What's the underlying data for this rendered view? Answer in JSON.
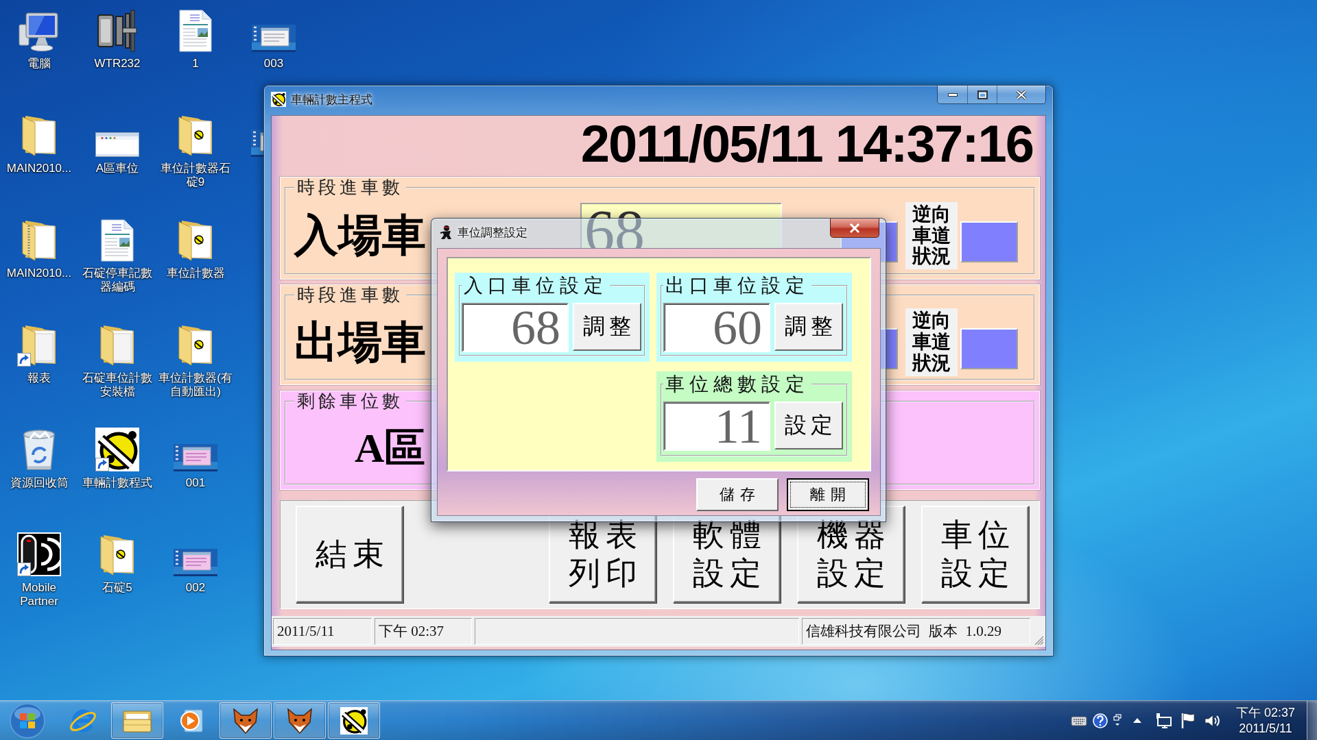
{
  "desktop": {
    "rows": [
      [
        {
          "kind": "computer",
          "label": "電腦",
          "shortcut": false
        },
        {
          "kind": "connector",
          "label": "WTR232",
          "shortcut": false
        },
        {
          "kind": "document",
          "label": "1",
          "shortcut": false
        },
        {
          "kind": "screenshot",
          "label": "003",
          "shortcut": false
        }
      ],
      [
        {
          "kind": "folder",
          "label": "MAIN2010...",
          "shortcut": false
        },
        {
          "kind": "app-window",
          "label": "A區車位",
          "shortcut": false
        },
        {
          "kind": "bell-folder",
          "label": "車位計數器石碇9",
          "shortcut": false
        },
        {
          "kind": "screenshot-edge"
        }
      ],
      [
        {
          "kind": "zip-folder",
          "label": "MAIN2010...",
          "shortcut": false
        },
        {
          "kind": "document",
          "label": "石碇停車記數器編碼",
          "shortcut": false
        },
        {
          "kind": "bell-folder",
          "label": "車位計數器",
          "shortcut": false
        }
      ],
      [
        {
          "kind": "paper-folder",
          "label": "報表",
          "shortcut": true
        },
        {
          "kind": "paper-folder",
          "label": "石碇車位計數安裝檔",
          "shortcut": false
        },
        {
          "kind": "bell-folder",
          "label": "車位計數器(有自動匯出)",
          "shortcut": false
        }
      ],
      [
        {
          "kind": "recycle-bin",
          "label": "資源回收筒",
          "shortcut": false
        },
        {
          "kind": "bell",
          "label": "車輛計數程式",
          "shortcut": true
        },
        {
          "kind": "app-screenshot",
          "label": "001",
          "shortcut": false
        }
      ],
      [
        {
          "kind": "mobile",
          "label": "Mobile Partner",
          "shortcut": true
        },
        {
          "kind": "bell-folder",
          "label": "石碇5",
          "shortcut": false
        },
        {
          "kind": "app-screenshot",
          "label": "002",
          "shortcut": false
        }
      ]
    ]
  },
  "main_window": {
    "title": "車輛計數主程式",
    "clock": "2011/05/11 14:37:16",
    "lanes": [
      {
        "legend": "時段進車數",
        "label": "入場車",
        "value": "68",
        "status_label": "逆向車道狀況"
      },
      {
        "legend": "時段進車數",
        "label": "出場車",
        "status_label": "逆向車道狀況"
      }
    ],
    "remaining": {
      "legend": "剩餘車位數",
      "label": "A區"
    },
    "buttons": [
      "結束",
      "報表列印",
      "軟體設定",
      "機器設定",
      "車位設定"
    ],
    "status_bar": {
      "date": "2011/5/11",
      "time": "下午 02:37",
      "info": "信雄科技有限公司 版本 1.0.29"
    }
  },
  "dialog": {
    "title": "車位調整設定",
    "groups": [
      {
        "kind": "adjust",
        "legend": "入口車位設定",
        "value": "68",
        "button": "調整"
      },
      {
        "kind": "adjust",
        "legend": "出口車位設定",
        "value": "60",
        "button": "調整"
      },
      {
        "kind": "total",
        "legend": "車位總數設定",
        "value": "11",
        "button": "設定"
      }
    ],
    "buttons": [
      {
        "label": "儲存",
        "focused": false
      },
      {
        "label": "離開",
        "focused": true
      }
    ]
  },
  "taskbar": {
    "apps": [
      {
        "kind": "browser",
        "running": false
      },
      {
        "kind": "explorer",
        "running": true
      },
      {
        "kind": "media",
        "running": false
      },
      {
        "kind": "fox",
        "running": true
      },
      {
        "kind": "fox",
        "running": true
      },
      {
        "kind": "bell",
        "running": true
      }
    ],
    "clock": {
      "time": "下午 02:37",
      "date": "2011/5/11"
    }
  }
}
